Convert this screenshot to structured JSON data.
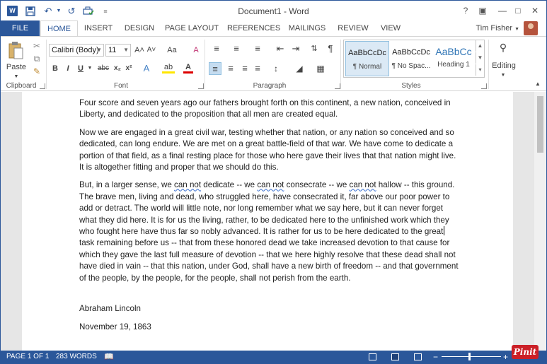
{
  "window": {
    "title": "Document1 - Word",
    "help": "?",
    "controls": [
      "▣",
      "—",
      "□",
      "✕"
    ]
  },
  "qat": {
    "undo": "↶",
    "redo": "↺",
    "more": "≡"
  },
  "tabs": {
    "file": "FILE",
    "items": [
      "HOME",
      "INSERT",
      "DESIGN",
      "PAGE LAYOUT",
      "REFERENCES",
      "MAILINGS",
      "REVIEW",
      "VIEW"
    ],
    "active": "HOME"
  },
  "user": {
    "name": "Tim Fisher"
  },
  "ribbon": {
    "clipboard": {
      "label": "Clipboard",
      "paste": "Paste"
    },
    "font": {
      "label": "Font",
      "family": "Calibri (Body)",
      "size": "11",
      "bold": "B",
      "italic": "I",
      "underline": "U",
      "strike": "abc",
      "subscript": "x₂",
      "superscript": "x²",
      "grow": "A˄",
      "shrink": "A˅",
      "case": "Aa",
      "clear": "A",
      "effects": "A",
      "highlight": "ab",
      "color": "A"
    },
    "paragraph": {
      "label": "Paragraph",
      "pilcrow": "¶"
    },
    "styles": {
      "label": "Styles",
      "items": [
        {
          "sample": "AaBbCcDc",
          "name": "¶ Normal",
          "selected": true
        },
        {
          "sample": "AaBbCcDc",
          "name": "¶ No Spac...",
          "selected": false
        },
        {
          "sample": "AaBbCc",
          "name": "Heading 1",
          "selected": false
        }
      ]
    },
    "editing": {
      "label": "Editing"
    }
  },
  "document": {
    "paragraphs": [
      "Four score and seven years ago our fathers brought forth on this continent, a new nation, conceived in Liberty, and dedicated to the proposition that all men are created equal.",
      "Now we are engaged in a great civil war, testing whether that nation, or any nation so conceived and so dedicated, can long endure. We are met on a great battle-field of that war. We have come to dedicate a portion of that field, as a final resting place for those who here gave their lives that that nation might live. It is altogether fitting and proper that we should do this."
    ],
    "p3_parts": [
      "But, in a larger sense, we ",
      "can not",
      " dedicate -- we ",
      "can not",
      " consecrate -- we ",
      "can not",
      " hallow -- this ground. The brave men, living and dead, who struggled here, have consecrated it, far above our poor power to add or detract. The world will little note, nor long remember what we say here, but it can never forget what they did here. It is for us the living, rather, to be dedicated here to the unfinished work which they who fought here have thus far so nobly advanced. It is rather for us to be here dedicated to the great",
      " task remaining before us -- that from these honored dead we take increased devotion to that cause for which they gave the last full measure of devotion -- that we here highly resolve that these dead shall not have died in vain -- that this nation, under God, shall have a new birth of freedom -- and that government of the people, by the people, for the people, shall not perish from the earth."
    ],
    "signature": "Abraham Lincoln",
    "date": "November 19, 1863"
  },
  "status": {
    "page": "PAGE 1 OF 1",
    "words": "283 WORDS",
    "zoom_minus": "−",
    "zoom_plus": "+",
    "zoom_level": "100%"
  },
  "overlay": {
    "pinit": "Pinit"
  },
  "colors": {
    "accent": "#2b579a",
    "pinit": "#cb2027"
  }
}
